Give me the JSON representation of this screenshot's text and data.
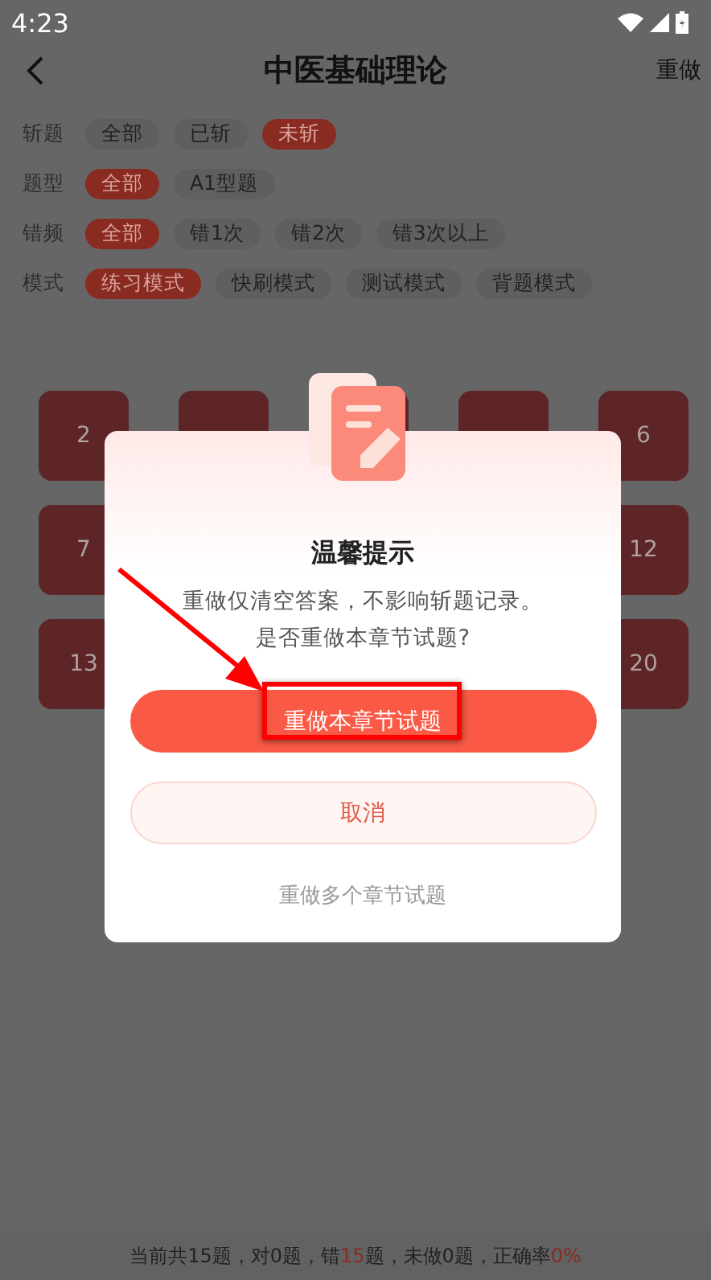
{
  "status_bar": {
    "time": "4:23"
  },
  "header": {
    "title": "中医基础理论",
    "action": "重做"
  },
  "filters": [
    {
      "label": "斩题",
      "options": [
        {
          "label": "全部",
          "selected": false
        },
        {
          "label": "已斩",
          "selected": false
        },
        {
          "label": "未斩",
          "selected": true
        }
      ]
    },
    {
      "label": "题型",
      "options": [
        {
          "label": "全部",
          "selected": true
        },
        {
          "label": "A1型题",
          "selected": false
        }
      ]
    },
    {
      "label": "错频",
      "options": [
        {
          "label": "全部",
          "selected": true
        },
        {
          "label": "错1次",
          "selected": false
        },
        {
          "label": "错2次",
          "selected": false
        },
        {
          "label": "错3次以上",
          "selected": false
        }
      ]
    },
    {
      "label": "模式",
      "options": [
        {
          "label": "练习模式",
          "selected": true
        },
        {
          "label": "快刷模式",
          "selected": false
        },
        {
          "label": "测试模式",
          "selected": false
        },
        {
          "label": "背题模式",
          "selected": false
        }
      ]
    }
  ],
  "grid": {
    "rows": [
      [
        "2",
        "6"
      ],
      [
        "7",
        "12"
      ],
      [
        "13",
        "20"
      ]
    ]
  },
  "dialog": {
    "title": "温馨提示",
    "message": [
      "重做仅清空答案，不影响斩题记录。",
      "是否重做本章节试题?"
    ],
    "primary_button": "重做本章节试题",
    "cancel_button": "取消",
    "link": "重做多个章节试题"
  },
  "summary": [
    {
      "text": "当前共15题，对0题，错",
      "highlight": false
    },
    {
      "text": "15",
      "highlight": true
    },
    {
      "text": "题，未做0题，正确率",
      "highlight": false
    },
    {
      "text": "0%",
      "highlight": true
    }
  ]
}
